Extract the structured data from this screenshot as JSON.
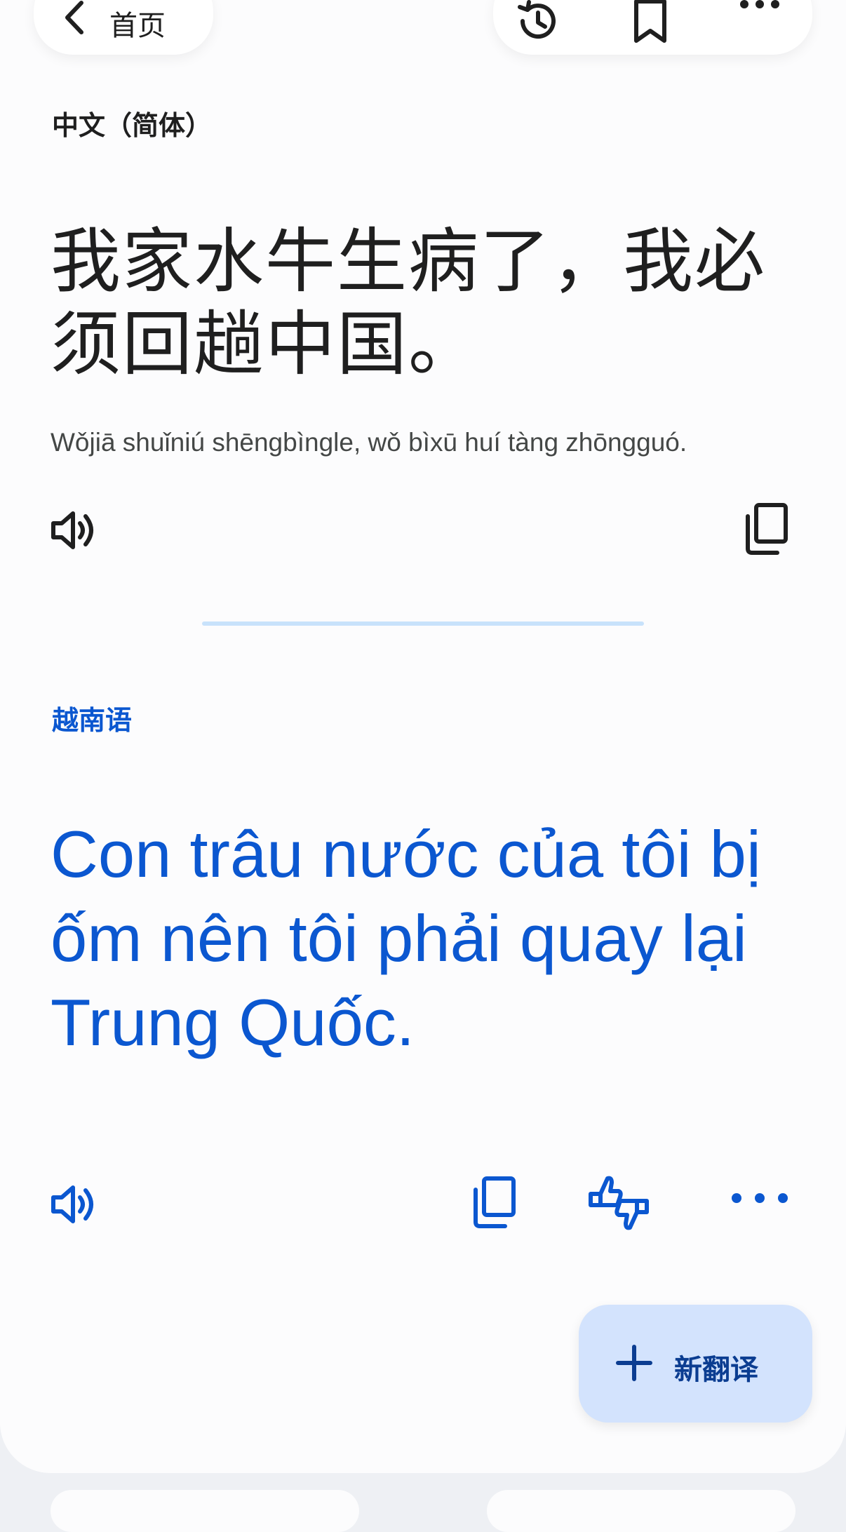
{
  "header": {
    "back_label": "首页"
  },
  "source": {
    "language": "中文（简体）",
    "text": "我家水牛生病了，我必须回趟中国。",
    "romanization": "Wǒjiā shuǐniú shēngbìngle, wǒ bìxū huí tàng zhōngguó."
  },
  "target": {
    "language": "越南语",
    "text": "Con trâu nước của tôi bị ốm nên tôi phải quay lại Trung Quốc."
  },
  "fab": {
    "label": "新翻译"
  },
  "colors": {
    "accent": "#0b57d0",
    "fab_bg": "#d3e3fd",
    "divider": "#c8e2fb",
    "text_primary": "#1f1f1f"
  },
  "icons": [
    "chevron-left-icon",
    "history-icon",
    "bookmark-icon",
    "more-horizontal-icon",
    "speaker-icon",
    "copy-icon",
    "feedback-icon",
    "plus-icon"
  ]
}
